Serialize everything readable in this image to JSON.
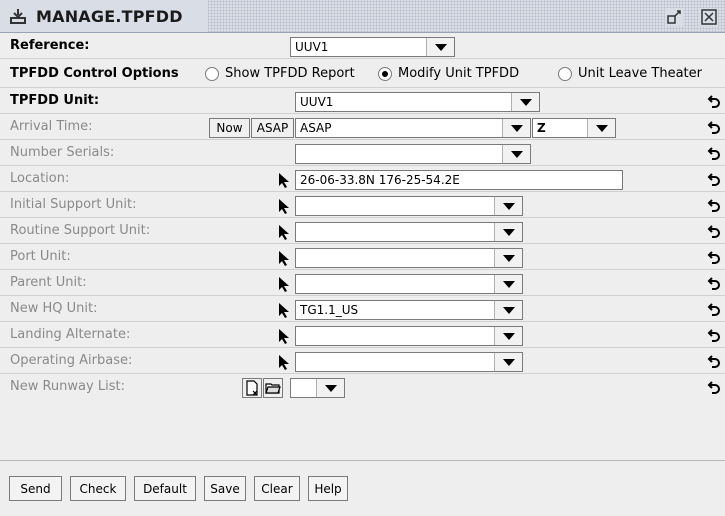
{
  "window": {
    "title": "MANAGE.TPFDD"
  },
  "reference": {
    "label": "Reference:",
    "value": "UUV1"
  },
  "control_options": {
    "label": "TPFDD Control Options",
    "options": [
      {
        "label": "Show TPFDD Report",
        "checked": false
      },
      {
        "label": "Modify Unit TPFDD",
        "checked": true
      },
      {
        "label": "Unit Leave Theater",
        "checked": false
      }
    ]
  },
  "fields": {
    "tpfdd_unit": {
      "label": "TPFDD Unit:",
      "value": "UUV1"
    },
    "arrival_time": {
      "label": "Arrival Time:",
      "now_label": "Now",
      "asap_label": "ASAP",
      "value": "ASAP",
      "zone": "Z"
    },
    "number_serials": {
      "label": "Number Serials:",
      "value": ""
    },
    "location": {
      "label": "Location:",
      "value": "26-06-33.8N 176-25-54.2E"
    },
    "initial_support_unit": {
      "label": "Initial Support Unit:",
      "value": ""
    },
    "routine_support_unit": {
      "label": "Routine Support Unit:",
      "value": ""
    },
    "port_unit": {
      "label": "Port Unit:",
      "value": ""
    },
    "parent_unit": {
      "label": "Parent Unit:",
      "value": ""
    },
    "new_hq_unit": {
      "label": "New HQ Unit:",
      "value": "TG1.1_US"
    },
    "landing_alternate": {
      "label": "Landing Alternate:",
      "value": ""
    },
    "operating_airbase": {
      "label": "Operating Airbase:",
      "value": ""
    },
    "new_runway_list": {
      "label": "New Runway List:",
      "value": ""
    }
  },
  "buttons": {
    "send": "Send",
    "check": "Check",
    "default": "Default",
    "save": "Save",
    "clear": "Clear",
    "help": "Help"
  },
  "icons": {
    "title": "tpfdd-app-icon",
    "restore": "restore-icon",
    "close": "close-icon",
    "undo": "undo-icon",
    "picker": "map-pointer-icon",
    "new_doc": "new-document-icon",
    "open_folder": "open-folder-icon"
  }
}
